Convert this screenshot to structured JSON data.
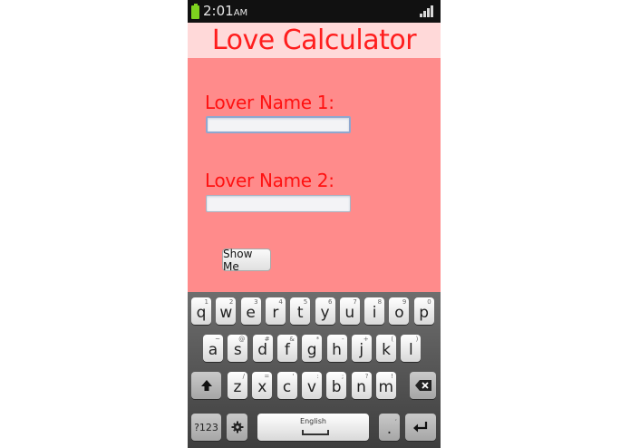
{
  "status_bar": {
    "time": "2:01",
    "ampm": "AM"
  },
  "app": {
    "title": "Love Calculator",
    "lover1_label": "Lover Name 1:",
    "lover2_label": "Lover Name 2:",
    "lover1_value": "",
    "lover2_value": "",
    "button_label": "Show Me"
  },
  "colors": {
    "background": "#ff8b8b",
    "title_bar": "#ffd9d9",
    "title_text": "#ff1d1d",
    "label_text": "#ff1111",
    "status_bar": "#111111"
  },
  "keyboard": {
    "row1": [
      {
        "key": "q",
        "hint": "1"
      },
      {
        "key": "w",
        "hint": "2"
      },
      {
        "key": "e",
        "hint": "3"
      },
      {
        "key": "r",
        "hint": "4"
      },
      {
        "key": "t",
        "hint": "5"
      },
      {
        "key": "y",
        "hint": "6"
      },
      {
        "key": "u",
        "hint": "7"
      },
      {
        "key": "i",
        "hint": "8"
      },
      {
        "key": "o",
        "hint": "9"
      },
      {
        "key": "p",
        "hint": "0"
      }
    ],
    "row2": [
      {
        "key": "a",
        "hint": "~"
      },
      {
        "key": "s",
        "hint": "@"
      },
      {
        "key": "d",
        "hint": "#"
      },
      {
        "key": "f",
        "hint": "&"
      },
      {
        "key": "g",
        "hint": "*"
      },
      {
        "key": "h",
        "hint": "-"
      },
      {
        "key": "j",
        "hint": "+"
      },
      {
        "key": "k",
        "hint": "("
      },
      {
        "key": "l",
        "hint": ")"
      }
    ],
    "row3": [
      {
        "key": "z",
        "hint": "/"
      },
      {
        "key": "x",
        "hint": "="
      },
      {
        "key": "c",
        "hint": "'"
      },
      {
        "key": "v",
        "hint": ":"
      },
      {
        "key": "b",
        "hint": ";"
      },
      {
        "key": "n",
        "hint": "?"
      },
      {
        "key": "m",
        "hint": "!"
      }
    ],
    "symbols_label": "?123",
    "space_label": "English",
    "period_label": ".",
    "period_hint": ","
  }
}
